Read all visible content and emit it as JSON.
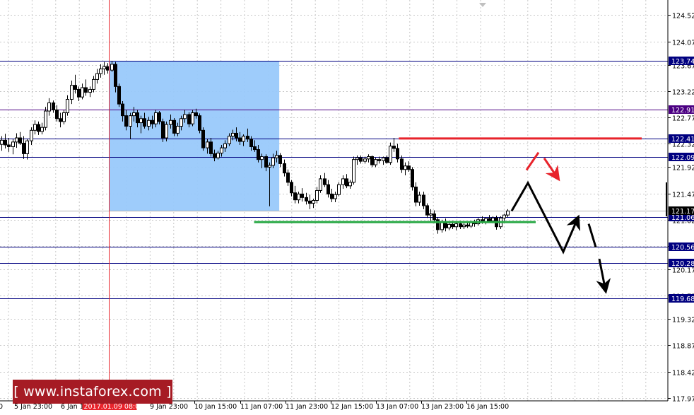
{
  "chart_data": {
    "type": "candlestick",
    "instrument_note": "",
    "y_axis": {
      "ticks": [
        124.52,
        124.07,
        123.67,
        123.22,
        122.77,
        122.32,
        121.92,
        121.47,
        121.02,
        120.57,
        120.17,
        119.72,
        119.32,
        118.87,
        118.42,
        117.97
      ],
      "range": [
        117.92,
        124.78
      ],
      "position": "right"
    },
    "x_axis": {
      "ticks": [
        "5 Jan 23:00",
        "6 Jan 1",
        "9 Jan 23:00",
        "10 Jan 15:00",
        "11 Jan 07:00",
        "11 Jan 23:00",
        "12 Jan 15:00",
        "13 Jan 07:00",
        "13 Jan 23:00",
        "16 Jan 15:00"
      ],
      "left_edge_label": "0",
      "cursor_label": "2017.01.09 08:00"
    },
    "grid": true,
    "levels": [
      {
        "price": 123.74,
        "label": "123.74",
        "color": "#000080"
      },
      {
        "price": 122.91,
        "label": "122.91",
        "color": "#4b0082"
      },
      {
        "price": 122.41,
        "label": "122.41",
        "color": "#000080"
      },
      {
        "price": 122.09,
        "label": "122.09",
        "color": "#000080"
      },
      {
        "price": 121.06,
        "label": "121.06",
        "color": "#000080"
      },
      {
        "price": 120.56,
        "label": "120.56",
        "color": "#000080"
      },
      {
        "price": 120.28,
        "label": "120.28",
        "color": "#000080"
      },
      {
        "price": 119.68,
        "label": "119.68",
        "color": "#000080"
      }
    ],
    "current_price": {
      "price": 121.17,
      "label": "121.17"
    },
    "resistance_segment": {
      "price": 122.41,
      "color": "#e8232b"
    },
    "support_segment": {
      "price": 120.98,
      "color": "#27a844"
    },
    "highlight_zone": {
      "price_top": 123.74,
      "price_bottom": 121.17,
      "color": "#99c9fb"
    },
    "scenario_paths": [
      {
        "name": "primary",
        "color": "#000000",
        "style": "solid",
        "points": [
          [
            121.17,
            0
          ],
          [
            121.65,
            1
          ],
          [
            120.47,
            2
          ],
          [
            121.06,
            3
          ]
        ]
      },
      {
        "name": "continuation",
        "color": "#000000",
        "style": "dashed",
        "points": [
          [
            120.95,
            0
          ],
          [
            120.37,
            1
          ],
          [
            119.8,
            2
          ]
        ]
      },
      {
        "name": "alternative",
        "color": "#e8232b",
        "style": "dashed",
        "points": [
          [
            121.87,
            0
          ],
          [
            122.17,
            1
          ],
          [
            121.72,
            2
          ]
        ]
      }
    ],
    "candles": [
      {
        "o": 122.31,
        "h": 122.45,
        "l": 122.2,
        "c": 122.38
      },
      {
        "o": 122.38,
        "h": 122.49,
        "l": 122.24,
        "c": 122.3
      },
      {
        "o": 122.3,
        "h": 122.42,
        "l": 122.18,
        "c": 122.27
      },
      {
        "o": 122.27,
        "h": 122.4,
        "l": 122.14,
        "c": 122.35
      },
      {
        "o": 122.35,
        "h": 122.5,
        "l": 122.25,
        "c": 122.42
      },
      {
        "o": 122.42,
        "h": 122.52,
        "l": 122.3,
        "c": 122.33
      },
      {
        "o": 122.33,
        "h": 122.45,
        "l": 122.06,
        "c": 122.15
      },
      {
        "o": 122.15,
        "h": 122.4,
        "l": 122.05,
        "c": 122.37
      },
      {
        "o": 122.37,
        "h": 122.6,
        "l": 122.3,
        "c": 122.55
      },
      {
        "o": 122.55,
        "h": 122.72,
        "l": 122.48,
        "c": 122.65
      },
      {
        "o": 122.65,
        "h": 122.7,
        "l": 122.47,
        "c": 122.53
      },
      {
        "o": 122.53,
        "h": 122.68,
        "l": 122.48,
        "c": 122.6
      },
      {
        "o": 122.6,
        "h": 122.95,
        "l": 122.55,
        "c": 122.88
      },
      {
        "o": 122.88,
        "h": 123.1,
        "l": 122.8,
        "c": 123.02
      },
      {
        "o": 123.02,
        "h": 123.06,
        "l": 122.85,
        "c": 122.9
      },
      {
        "o": 122.9,
        "h": 122.98,
        "l": 122.7,
        "c": 122.75
      },
      {
        "o": 122.75,
        "h": 122.85,
        "l": 122.6,
        "c": 122.7
      },
      {
        "o": 122.7,
        "h": 122.9,
        "l": 122.65,
        "c": 122.85
      },
      {
        "o": 122.85,
        "h": 123.15,
        "l": 122.8,
        "c": 123.08
      },
      {
        "o": 123.08,
        "h": 123.4,
        "l": 123.0,
        "c": 123.32
      },
      {
        "o": 123.32,
        "h": 123.5,
        "l": 123.18,
        "c": 123.25
      },
      {
        "o": 123.25,
        "h": 123.3,
        "l": 123.05,
        "c": 123.12
      },
      {
        "o": 123.12,
        "h": 123.35,
        "l": 123.08,
        "c": 123.28
      },
      {
        "o": 123.28,
        "h": 123.42,
        "l": 123.14,
        "c": 123.2
      },
      {
        "o": 123.2,
        "h": 123.3,
        "l": 123.12,
        "c": 123.25
      },
      {
        "o": 123.25,
        "h": 123.48,
        "l": 123.2,
        "c": 123.42
      },
      {
        "o": 123.42,
        "h": 123.6,
        "l": 123.35,
        "c": 123.52
      },
      {
        "o": 123.52,
        "h": 123.68,
        "l": 123.45,
        "c": 123.6
      },
      {
        "o": 123.6,
        "h": 123.72,
        "l": 123.5,
        "c": 123.64
      },
      {
        "o": 123.64,
        "h": 123.7,
        "l": 123.52,
        "c": 123.58
      },
      {
        "o": 123.58,
        "h": 123.74,
        "l": 123.55,
        "c": 123.68
      },
      {
        "o": 123.68,
        "h": 123.72,
        "l": 123.2,
        "c": 123.3
      },
      {
        "o": 123.3,
        "h": 123.35,
        "l": 122.95,
        "c": 123.0
      },
      {
        "o": 123.0,
        "h": 123.05,
        "l": 122.7,
        "c": 122.8
      },
      {
        "o": 122.8,
        "h": 122.9,
        "l": 122.55,
        "c": 122.62
      },
      {
        "o": 122.62,
        "h": 122.85,
        "l": 122.4,
        "c": 122.8
      },
      {
        "o": 122.8,
        "h": 122.95,
        "l": 122.7,
        "c": 122.85
      },
      {
        "o": 122.85,
        "h": 122.9,
        "l": 122.6,
        "c": 122.68
      },
      {
        "o": 122.68,
        "h": 122.8,
        "l": 122.5,
        "c": 122.75
      },
      {
        "o": 122.75,
        "h": 122.85,
        "l": 122.58,
        "c": 122.62
      },
      {
        "o": 122.62,
        "h": 122.78,
        "l": 122.55,
        "c": 122.72
      },
      {
        "o": 122.72,
        "h": 122.8,
        "l": 122.58,
        "c": 122.66
      },
      {
        "o": 122.66,
        "h": 122.9,
        "l": 122.6,
        "c": 122.85
      },
      {
        "o": 122.85,
        "h": 122.88,
        "l": 122.65,
        "c": 122.7
      },
      {
        "o": 122.7,
        "h": 122.75,
        "l": 122.35,
        "c": 122.42
      },
      {
        "o": 122.42,
        "h": 122.7,
        "l": 122.36,
        "c": 122.65
      },
      {
        "o": 122.65,
        "h": 122.82,
        "l": 122.58,
        "c": 122.72
      },
      {
        "o": 122.72,
        "h": 122.76,
        "l": 122.45,
        "c": 122.5
      },
      {
        "o": 122.5,
        "h": 122.68,
        "l": 122.45,
        "c": 122.62
      },
      {
        "o": 122.62,
        "h": 122.8,
        "l": 122.55,
        "c": 122.75
      },
      {
        "o": 122.75,
        "h": 122.9,
        "l": 122.68,
        "c": 122.82
      },
      {
        "o": 122.82,
        "h": 122.86,
        "l": 122.6,
        "c": 122.66
      },
      {
        "o": 122.66,
        "h": 122.9,
        "l": 122.62,
        "c": 122.85
      },
      {
        "o": 122.85,
        "h": 122.92,
        "l": 122.75,
        "c": 122.8
      },
      {
        "o": 122.8,
        "h": 122.84,
        "l": 122.5,
        "c": 122.55
      },
      {
        "o": 122.55,
        "h": 122.6,
        "l": 122.2,
        "c": 122.25
      },
      {
        "o": 122.25,
        "h": 122.4,
        "l": 122.15,
        "c": 122.35
      },
      {
        "o": 122.35,
        "h": 122.42,
        "l": 122.1,
        "c": 122.15
      },
      {
        "o": 122.15,
        "h": 122.22,
        "l": 122.02,
        "c": 122.08
      },
      {
        "o": 122.08,
        "h": 122.2,
        "l": 122.05,
        "c": 122.16
      },
      {
        "o": 122.16,
        "h": 122.3,
        "l": 122.1,
        "c": 122.25
      },
      {
        "o": 122.25,
        "h": 122.38,
        "l": 122.18,
        "c": 122.32
      },
      {
        "o": 122.32,
        "h": 122.5,
        "l": 122.28,
        "c": 122.45
      },
      {
        "o": 122.45,
        "h": 122.56,
        "l": 122.38,
        "c": 122.5
      },
      {
        "o": 122.5,
        "h": 122.6,
        "l": 122.36,
        "c": 122.42
      },
      {
        "o": 122.42,
        "h": 122.52,
        "l": 122.3,
        "c": 122.36
      },
      {
        "o": 122.36,
        "h": 122.48,
        "l": 122.28,
        "c": 122.45
      },
      {
        "o": 122.45,
        "h": 122.58,
        "l": 122.35,
        "c": 122.4
      },
      {
        "o": 122.4,
        "h": 122.45,
        "l": 122.2,
        "c": 122.27
      },
      {
        "o": 122.27,
        "h": 122.38,
        "l": 122.18,
        "c": 122.22
      },
      {
        "o": 122.22,
        "h": 122.3,
        "l": 122.0,
        "c": 122.05
      },
      {
        "o": 122.05,
        "h": 122.15,
        "l": 121.9,
        "c": 122.1
      },
      {
        "o": 122.1,
        "h": 122.14,
        "l": 121.85,
        "c": 121.92
      },
      {
        "o": 121.92,
        "h": 122.0,
        "l": 121.25,
        "c": 121.95
      },
      {
        "o": 121.95,
        "h": 122.15,
        "l": 121.9,
        "c": 122.08
      },
      {
        "o": 122.08,
        "h": 122.2,
        "l": 122.0,
        "c": 122.12
      },
      {
        "o": 122.12,
        "h": 122.16,
        "l": 121.92,
        "c": 121.98
      },
      {
        "o": 121.98,
        "h": 122.05,
        "l": 121.76,
        "c": 121.82
      },
      {
        "o": 121.82,
        "h": 121.88,
        "l": 121.6,
        "c": 121.66
      },
      {
        "o": 121.66,
        "h": 121.7,
        "l": 121.42,
        "c": 121.48
      },
      {
        "o": 121.48,
        "h": 121.6,
        "l": 121.3,
        "c": 121.36
      },
      {
        "o": 121.36,
        "h": 121.5,
        "l": 121.3,
        "c": 121.46
      },
      {
        "o": 121.46,
        "h": 121.56,
        "l": 121.33,
        "c": 121.4
      },
      {
        "o": 121.4,
        "h": 121.48,
        "l": 121.28,
        "c": 121.34
      },
      {
        "o": 121.34,
        "h": 121.45,
        "l": 121.2,
        "c": 121.3
      },
      {
        "o": 121.3,
        "h": 121.38,
        "l": 121.22,
        "c": 121.35
      },
      {
        "o": 121.35,
        "h": 121.58,
        "l": 121.3,
        "c": 121.52
      },
      {
        "o": 121.52,
        "h": 121.78,
        "l": 121.48,
        "c": 121.72
      },
      {
        "o": 121.72,
        "h": 121.82,
        "l": 121.58,
        "c": 121.62
      },
      {
        "o": 121.62,
        "h": 121.7,
        "l": 121.4,
        "c": 121.46
      },
      {
        "o": 121.46,
        "h": 121.55,
        "l": 121.32,
        "c": 121.38
      },
      {
        "o": 121.38,
        "h": 121.5,
        "l": 121.32,
        "c": 121.45
      },
      {
        "o": 121.45,
        "h": 121.66,
        "l": 121.42,
        "c": 121.62
      },
      {
        "o": 121.62,
        "h": 121.78,
        "l": 121.55,
        "c": 121.72
      },
      {
        "o": 121.72,
        "h": 121.8,
        "l": 121.56,
        "c": 121.6
      },
      {
        "o": 121.6,
        "h": 121.7,
        "l": 121.55,
        "c": 121.66
      },
      {
        "o": 121.66,
        "h": 122.1,
        "l": 121.62,
        "c": 122.05
      },
      {
        "o": 122.05,
        "h": 122.12,
        "l": 121.96,
        "c": 122.08
      },
      {
        "o": 122.08,
        "h": 122.12,
        "l": 121.98,
        "c": 122.02
      },
      {
        "o": 122.02,
        "h": 122.1,
        "l": 121.98,
        "c": 122.06
      },
      {
        "o": 122.06,
        "h": 122.14,
        "l": 122.0,
        "c": 122.1
      },
      {
        "o": 122.1,
        "h": 122.12,
        "l": 121.92,
        "c": 121.96
      },
      {
        "o": 121.96,
        "h": 122.08,
        "l": 121.92,
        "c": 122.05
      },
      {
        "o": 122.05,
        "h": 122.1,
        "l": 121.98,
        "c": 122.03
      },
      {
        "o": 122.03,
        "h": 122.1,
        "l": 121.96,
        "c": 122.08
      },
      {
        "o": 122.08,
        "h": 122.12,
        "l": 121.98,
        "c": 122.0
      },
      {
        "o": 122.0,
        "h": 122.34,
        "l": 121.96,
        "c": 122.28
      },
      {
        "o": 122.28,
        "h": 122.42,
        "l": 122.18,
        "c": 122.24
      },
      {
        "o": 122.24,
        "h": 122.32,
        "l": 122.0,
        "c": 122.06
      },
      {
        "o": 122.06,
        "h": 122.12,
        "l": 121.82,
        "c": 121.88
      },
      {
        "o": 121.88,
        "h": 122.0,
        "l": 121.78,
        "c": 121.94
      },
      {
        "o": 121.94,
        "h": 122.02,
        "l": 121.84,
        "c": 121.88
      },
      {
        "o": 121.88,
        "h": 121.92,
        "l": 121.52,
        "c": 121.58
      },
      {
        "o": 121.58,
        "h": 121.66,
        "l": 121.25,
        "c": 121.32
      },
      {
        "o": 121.32,
        "h": 121.5,
        "l": 121.26,
        "c": 121.44
      },
      {
        "o": 121.44,
        "h": 121.5,
        "l": 121.2,
        "c": 121.26
      },
      {
        "o": 121.26,
        "h": 121.3,
        "l": 121.05,
        "c": 121.1
      },
      {
        "o": 121.1,
        "h": 121.2,
        "l": 121.0,
        "c": 121.12
      },
      {
        "o": 121.12,
        "h": 121.18,
        "l": 120.96,
        "c": 121.02
      },
      {
        "o": 121.02,
        "h": 121.06,
        "l": 120.78,
        "c": 120.85
      },
      {
        "o": 120.85,
        "h": 121.02,
        "l": 120.8,
        "c": 120.98
      },
      {
        "o": 120.98,
        "h": 121.04,
        "l": 120.82,
        "c": 120.88
      },
      {
        "o": 120.88,
        "h": 120.98,
        "l": 120.84,
        "c": 120.94
      },
      {
        "o": 120.94,
        "h": 121.0,
        "l": 120.86,
        "c": 120.9
      },
      {
        "o": 120.9,
        "h": 120.98,
        "l": 120.84,
        "c": 120.95
      },
      {
        "o": 120.95,
        "h": 121.0,
        "l": 120.86,
        "c": 120.9
      },
      {
        "o": 120.9,
        "h": 120.96,
        "l": 120.86,
        "c": 120.93
      },
      {
        "o": 120.93,
        "h": 120.98,
        "l": 120.88,
        "c": 120.91
      },
      {
        "o": 120.91,
        "h": 121.0,
        "l": 120.88,
        "c": 120.97
      },
      {
        "o": 120.97,
        "h": 121.02,
        "l": 120.9,
        "c": 120.95
      },
      {
        "o": 120.95,
        "h": 121.05,
        "l": 120.92,
        "c": 121.02
      },
      {
        "o": 121.02,
        "h": 121.08,
        "l": 120.95,
        "c": 120.98
      },
      {
        "o": 120.98,
        "h": 121.06,
        "l": 120.94,
        "c": 121.04
      },
      {
        "o": 121.04,
        "h": 121.1,
        "l": 120.98,
        "c": 121.0
      },
      {
        "o": 121.0,
        "h": 121.08,
        "l": 120.96,
        "c": 121.05
      },
      {
        "o": 121.05,
        "h": 121.09,
        "l": 120.85,
        "c": 120.9
      },
      {
        "o": 120.9,
        "h": 121.08,
        "l": 120.86,
        "c": 121.05
      },
      {
        "o": 121.05,
        "h": 121.12,
        "l": 121.0,
        "c": 121.1
      },
      {
        "o": 121.1,
        "h": 121.2,
        "l": 121.06,
        "c": 121.17
      }
    ]
  }
}
